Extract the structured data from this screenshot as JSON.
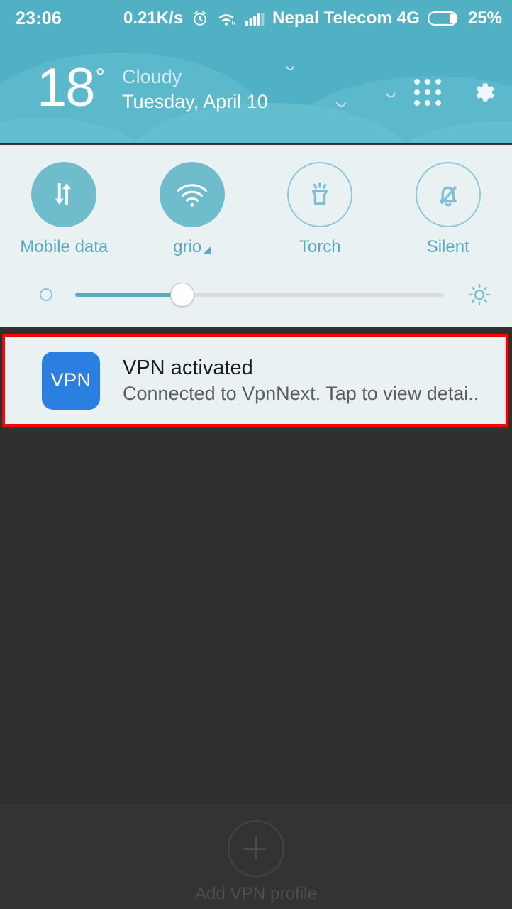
{
  "status_bar": {
    "clock": "23:06",
    "net_speed": "0.21K/s",
    "alarm_icon": "alarm-icon",
    "wifi_icon": "wifi-icon",
    "signal_icon": "signal-bars-icon",
    "carrier": "Nepal Telecom 4G",
    "battery_icon": "battery-icon",
    "battery_percent": "25%"
  },
  "weather": {
    "temperature": "18",
    "degree": "°",
    "condition": "Cloudy",
    "date": "Tuesday, April 10",
    "apps_grid_icon": "apps-grid-icon",
    "settings_icon": "gear-icon"
  },
  "quick_settings": {
    "toggles": [
      {
        "label": "Mobile data",
        "icon": "mobile-data-icon",
        "state": "on"
      },
      {
        "label": "grio",
        "icon": "wifi-icon",
        "state": "on"
      },
      {
        "label": "Torch",
        "icon": "torch-icon",
        "state": "off"
      },
      {
        "label": "Silent",
        "icon": "bell-off-icon",
        "state": "off"
      }
    ],
    "brightness": {
      "low_icon": "brightness-low-icon",
      "high_icon": "brightness-sun-icon",
      "value_percent": "29"
    }
  },
  "notification": {
    "icon_label": "VPN",
    "title": "VPN activated",
    "subtitle": "Connected to VpnNext. Tap to view detai..",
    "highlight_color": "#fe0000"
  },
  "vpn_page": {
    "add_profile_label": "Add VPN profile",
    "add_icon": "plus-icon"
  },
  "colors": {
    "teal": "#4fb0c6",
    "status_bar": "#52b0c4",
    "panel": "#eaf1f2",
    "accent_text": "#5aabc0",
    "vpn_blue": "#2a7fe0",
    "dark_bg": "#303030"
  }
}
